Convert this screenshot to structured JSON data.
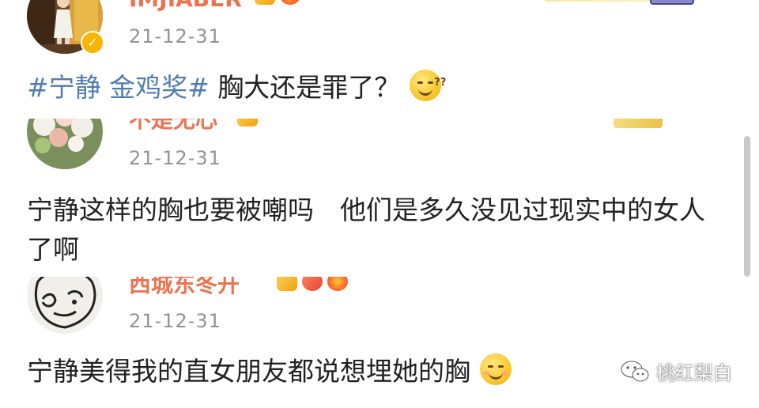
{
  "comments": [
    {
      "username": "IMJIABER",
      "timestamp": "21-12-31",
      "hashtag": "#宁静 金鸡奖#",
      "text": " 胸大还是罪了？",
      "emoji": "sweat-smile-icon",
      "verified": true
    },
    {
      "username": "不是无心",
      "timestamp": "21-12-31",
      "text": "宁静这样的胸也要被嘲吗　他们是多久没见过现实中的女人了啊"
    },
    {
      "username": "西城东冬开",
      "timestamp": "21-12-31",
      "text": "宁静美得我的直女朋友都说想埋她的胸",
      "emoji": "smile-icon"
    }
  ],
  "watermark": {
    "text": "桃红梨白",
    "icon": "wechat-icon"
  },
  "colors": {
    "hashtag": "#507daf",
    "username": "#eb7350",
    "timestamp": "#939393",
    "verified_badge": "#f7b500"
  }
}
